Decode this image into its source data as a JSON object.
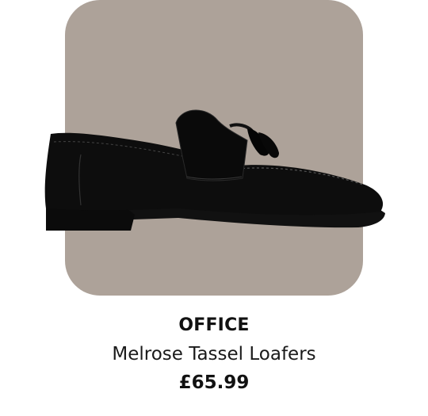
{
  "product": {
    "brand": "OFFICE",
    "name": "Melrose Tassel Loafers",
    "price": "£65.99",
    "image_icon": "black-suede-tassel-loafer-image",
    "image_background": "#ada299"
  }
}
